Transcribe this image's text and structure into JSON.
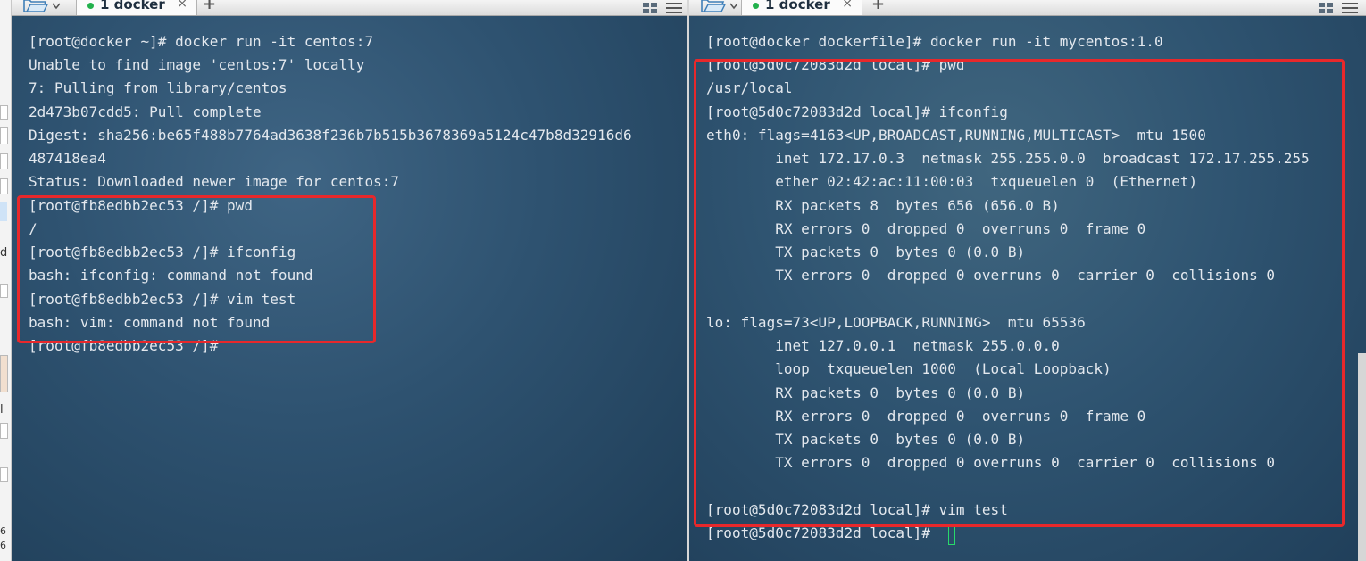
{
  "left_pane": {
    "tab": {
      "label": "1 docker",
      "close": "×",
      "add": "+"
    },
    "lines": [
      "[root@docker ~]# docker run -it centos:7",
      "Unable to find image 'centos:7' locally",
      "7: Pulling from library/centos",
      "2d473b07cdd5: Pull complete",
      "Digest: sha256:be65f488b7764ad3638f236b7b515b3678369a5124c47b8d32916d6",
      "487418ea4",
      "Status: Downloaded newer image for centos:7",
      "[root@fb8edbb2ec53 /]# pwd",
      "/",
      "[root@fb8edbb2ec53 /]# ifconfig",
      "bash: ifconfig: command not found",
      "[root@fb8edbb2ec53 /]# vim test",
      "bash: vim: command not found",
      "[root@fb8edbb2ec53 /]#"
    ]
  },
  "right_pane": {
    "tab": {
      "label": "1 docker",
      "close": "×",
      "add": "+"
    },
    "lines": [
      "[root@docker dockerfile]# docker run -it mycentos:1.0",
      "[root@5d0c72083d2d local]# pwd",
      "/usr/local",
      "[root@5d0c72083d2d local]# ifconfig",
      "eth0: flags=4163<UP,BROADCAST,RUNNING,MULTICAST>  mtu 1500",
      "        inet 172.17.0.3  netmask 255.255.0.0  broadcast 172.17.255.255",
      "        ether 02:42:ac:11:00:03  txqueuelen 0  (Ethernet)",
      "        RX packets 8  bytes 656 (656.0 B)",
      "        RX errors 0  dropped 0  overruns 0  frame 0",
      "        TX packets 0  bytes 0 (0.0 B)",
      "        TX errors 0  dropped 0 overruns 0  carrier 0  collisions 0",
      "",
      "lo: flags=73<UP,LOOPBACK,RUNNING>  mtu 65536",
      "        inet 127.0.0.1  netmask 255.0.0.0",
      "        loop  txqueuelen 1000  (Local Loopback)",
      "        RX packets 0  bytes 0 (0.0 B)",
      "        RX errors 0  dropped 0  overruns 0  frame 0",
      "        TX packets 0  bytes 0 (0.0 B)",
      "        TX errors 0  dropped 0 overruns 0  carrier 0  collisions 0",
      "",
      "[root@5d0c72083d2d local]# vim test",
      "[root@5d0c72083d2d local]#"
    ]
  },
  "side_strip": {
    "chars": [
      "d",
      "l",
      "6",
      "6"
    ]
  },
  "colors": {
    "terminal_text": "#e3e8ee",
    "highlight_box": "#e8282b",
    "tab_dot": "#22b14c",
    "cursor": "#28d96b"
  },
  "icons": {
    "folder": "folder-open-icon",
    "layout": "layout-grid-icon",
    "menu": "hamburger-menu-icon",
    "close": "close-icon",
    "add": "add-tab-icon",
    "status": "session-status-dot-icon"
  }
}
